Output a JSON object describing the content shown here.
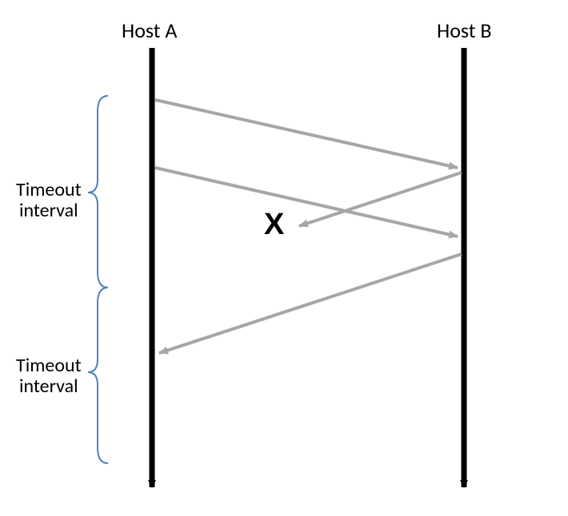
{
  "hostA": "Host A",
  "hostB": "Host B",
  "timeout1": "Timeout\ninterval",
  "timeout2": "Timeout\ninterval",
  "lostMarker": "X"
}
